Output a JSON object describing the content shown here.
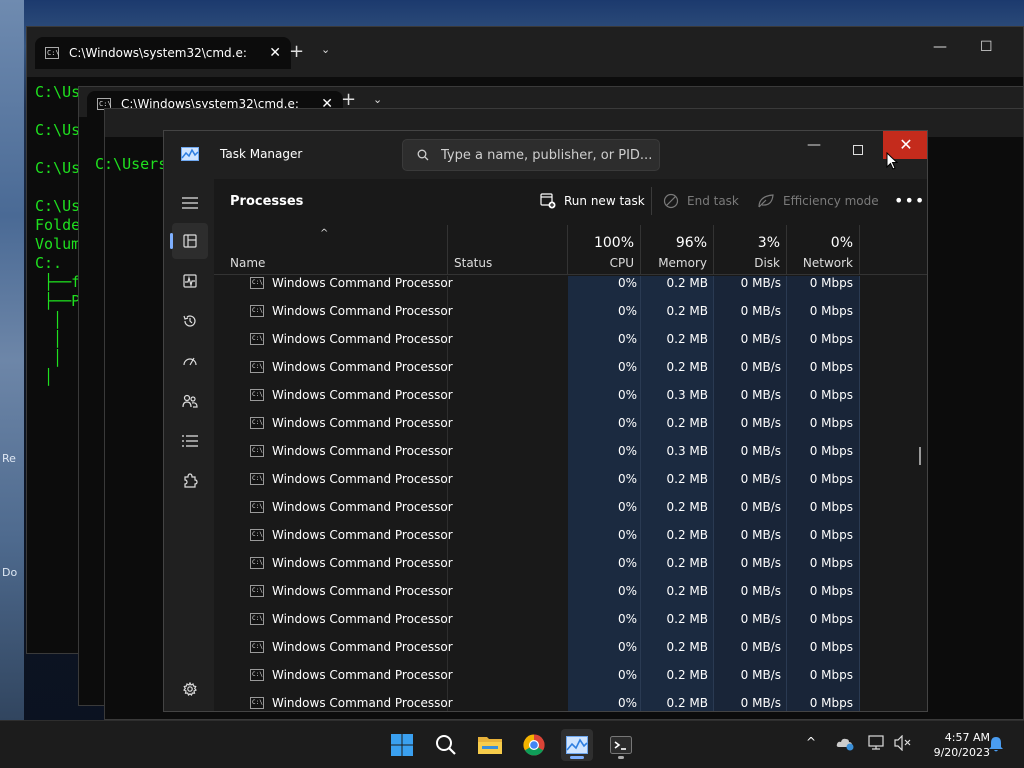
{
  "desktop": {
    "left_labels": [
      "Re",
      "Do"
    ]
  },
  "terminal_front": {
    "tab_title": "C:\\Windows\\system32\\cmd.e:",
    "lines": [
      "C:\\Us",
      "",
      "C:\\Us",
      "",
      "C:\\Us",
      "",
      "C:\\Us",
      "Folde",
      "Volum",
      "C:.",
      " ├──f",
      " ├──P",
      "  │",
      "  │",
      "  │",
      " │"
    ]
  },
  "terminal_middle": {
    "tab_title": "C:\\Windows\\system32\\cmd.e:",
    "lines": [
      "C:\\Users\\"
    ]
  },
  "task_manager": {
    "title": "Task Manager",
    "search_placeholder": "Type a name, publisher, or PID...",
    "page_title": "Processes",
    "toolbar": {
      "run_new_task": "Run new task",
      "end_task": "End task",
      "efficiency_mode": "Efficiency mode",
      "more": "•••"
    },
    "columns": {
      "name": "Name",
      "status": "Status",
      "cpu_pct": "100%",
      "cpu": "CPU",
      "memory_pct": "96%",
      "memory": "Memory",
      "disk_pct": "3%",
      "disk": "Disk",
      "network_pct": "0%",
      "network": "Network"
    },
    "rows": [
      {
        "name": "Windows Command Processor",
        "cpu": "0%",
        "memory": "0.2 MB",
        "disk": "0 MB/s",
        "network": "0 Mbps"
      },
      {
        "name": "Windows Command Processor",
        "cpu": "0%",
        "memory": "0.2 MB",
        "disk": "0 MB/s",
        "network": "0 Mbps"
      },
      {
        "name": "Windows Command Processor",
        "cpu": "0%",
        "memory": "0.2 MB",
        "disk": "0 MB/s",
        "network": "0 Mbps"
      },
      {
        "name": "Windows Command Processor",
        "cpu": "0%",
        "memory": "0.2 MB",
        "disk": "0 MB/s",
        "network": "0 Mbps"
      },
      {
        "name": "Windows Command Processor",
        "cpu": "0%",
        "memory": "0.3 MB",
        "disk": "0 MB/s",
        "network": "0 Mbps"
      },
      {
        "name": "Windows Command Processor",
        "cpu": "0%",
        "memory": "0.2 MB",
        "disk": "0 MB/s",
        "network": "0 Mbps"
      },
      {
        "name": "Windows Command Processor",
        "cpu": "0%",
        "memory": "0.3 MB",
        "disk": "0 MB/s",
        "network": "0 Mbps"
      },
      {
        "name": "Windows Command Processor",
        "cpu": "0%",
        "memory": "0.2 MB",
        "disk": "0 MB/s",
        "network": "0 Mbps"
      },
      {
        "name": "Windows Command Processor",
        "cpu": "0%",
        "memory": "0.2 MB",
        "disk": "0 MB/s",
        "network": "0 Mbps"
      },
      {
        "name": "Windows Command Processor",
        "cpu": "0%",
        "memory": "0.2 MB",
        "disk": "0 MB/s",
        "network": "0 Mbps"
      },
      {
        "name": "Windows Command Processor",
        "cpu": "0%",
        "memory": "0.2 MB",
        "disk": "0 MB/s",
        "network": "0 Mbps"
      },
      {
        "name": "Windows Command Processor",
        "cpu": "0%",
        "memory": "0.2 MB",
        "disk": "0 MB/s",
        "network": "0 Mbps"
      },
      {
        "name": "Windows Command Processor",
        "cpu": "0%",
        "memory": "0.2 MB",
        "disk": "0 MB/s",
        "network": "0 Mbps"
      },
      {
        "name": "Windows Command Processor",
        "cpu": "0%",
        "memory": "0.2 MB",
        "disk": "0 MB/s",
        "network": "0 Mbps"
      },
      {
        "name": "Windows Command Processor",
        "cpu": "0%",
        "memory": "0.2 MB",
        "disk": "0 MB/s",
        "network": "0 Mbps"
      },
      {
        "name": "Windows Command Processor",
        "cpu": "0%",
        "memory": "0.2 MB",
        "disk": "0 MB/s",
        "network": "0 Mbps"
      }
    ]
  },
  "taskbar": {
    "time": "4:57 AM",
    "date": "9/20/2023"
  },
  "colors": {
    "accent": "#7fb0ff",
    "close_red": "#c42b1c",
    "column_highlight": "#1b2a40",
    "terminal_text": "#1fe01f"
  }
}
